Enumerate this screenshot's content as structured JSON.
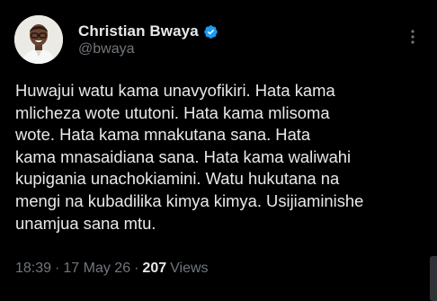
{
  "author": {
    "display_name": "Christian Bwaya",
    "handle": "@bwaya",
    "verified": true,
    "verified_color": "#1d9bf0"
  },
  "tweet": {
    "text": "Huwajui watu kama unavyofikiri. Hata kama\nmlicheza wote ututoni. Hata kama mlisoma\nwote. Hata kama mnakutana sana. Hata\nkama mnasaidiana sana. Hata kama waliwahi\nkupigania unachokiamini. Watu hukutana na\nmengi na kubadilika kimya kimya. Usijiaminishe\nunamjua sana mtu."
  },
  "meta": {
    "time": "18:39",
    "separator": "·",
    "date": "17 May 26",
    "views_count": "207",
    "views_label": "Views"
  },
  "icons": {
    "avatar": "avatar-photo",
    "verified": "verified-badge-icon",
    "more": "more-options-icon"
  },
  "colors": {
    "background": "#000000",
    "text_primary": "#e7e9ea",
    "text_secondary": "#71767b",
    "accent": "#1d9bf0"
  }
}
